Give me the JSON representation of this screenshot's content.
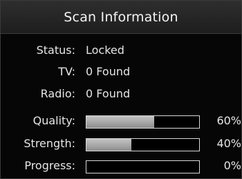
{
  "header": {
    "title": "Scan Information"
  },
  "info": {
    "status": {
      "label": "Status:",
      "value": "Locked"
    },
    "tv": {
      "label": "TV:",
      "value": "0 Found"
    },
    "radio": {
      "label": "Radio:",
      "value": "0 Found"
    }
  },
  "meters": {
    "quality": {
      "label": "Quality:",
      "percent_text": "60%",
      "fraction": 0.6
    },
    "strength": {
      "label": "Strength:",
      "percent_text": "40%",
      "fraction": 0.4
    },
    "progress": {
      "label": "Progress:",
      "percent_text": "0%",
      "fraction": 0.0
    }
  },
  "colors": {
    "background": "#060606",
    "header": "#262626",
    "bar_fill": "#a8a8a8",
    "bar_border": "#d8d8d8",
    "text": "#e6e6e6"
  }
}
